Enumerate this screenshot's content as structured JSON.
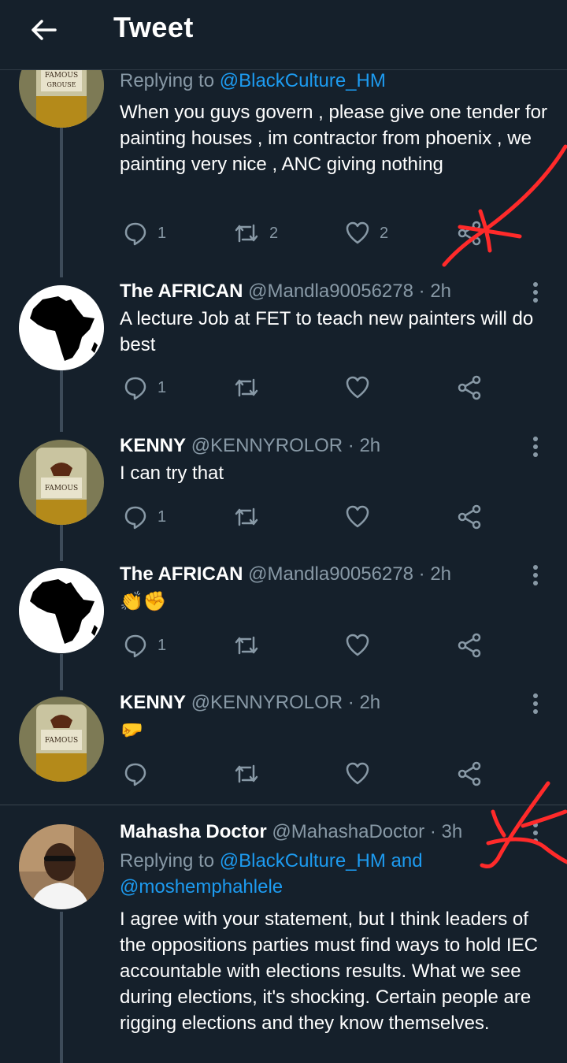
{
  "header": {
    "title": "Tweet"
  },
  "tweets": [
    {
      "replying_prefix": "Replying to ",
      "replying_to": "@BlackCulture_HM",
      "text": "When you guys govern , please give one tender for painting houses , im contractor from phoenix , we painting very nice , ANC giving nothing",
      "reply_count": "1",
      "retweet_count": "2",
      "like_count": "2"
    },
    {
      "name": "The AFRICAN",
      "handle": "@Mandla90056278",
      "time": "2h",
      "text": "A lecture Job at FET to teach new painters will do best",
      "reply_count": "1"
    },
    {
      "name": "KENNY",
      "handle": "@KENNYROLOR",
      "time": "2h",
      "text": "I can try that",
      "reply_count": "1"
    },
    {
      "name": "The AFRICAN",
      "handle": "@Mandla90056278",
      "time": "2h",
      "text": "👏✊",
      "reply_count": "1"
    },
    {
      "name": "KENNY",
      "handle": "@KENNYROLOR",
      "time": "2h",
      "text": "🤛"
    },
    {
      "name": "Mahasha Doctor",
      "handle": "@MahashaDoctor",
      "time": "3h",
      "replying_prefix": "Replying to ",
      "replying_to": "@BlackCulture_HM",
      "replying_and": " and",
      "replying_to_2": "@moshemphahlele",
      "text": "I agree with your statement, but I think leaders of the oppositions parties must find ways to hold IEC accountable with elections results. What we see during elections, it's shocking. Certain people are rigging elections and they know themselves."
    }
  ],
  "separator": "·",
  "colors": {
    "background": "#15202b",
    "secondary_text": "#8899a6",
    "link": "#1d9bf0",
    "annotation": "#ff2a2a"
  }
}
